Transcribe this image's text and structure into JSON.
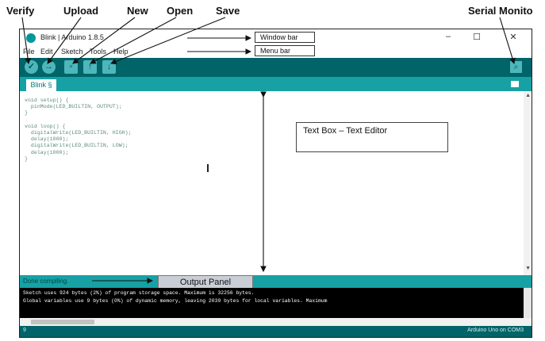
{
  "callouts": {
    "verify": "Verify",
    "upload": "Upload",
    "new": "New",
    "open": "Open",
    "save": "Save",
    "serial_monitor": "Serial Monito"
  },
  "window": {
    "title": "Blink | Arduino 1.8.5",
    "window_bar_label": "Window bar",
    "menu_bar_label": "Menu bar",
    "controls": [
      "–",
      "☐",
      "✕"
    ]
  },
  "menu": [
    "File",
    "Edit",
    "Sketch",
    "Tools",
    "Help"
  ],
  "toolbar": {
    "verify_icon": "✓",
    "upload_icon": "→",
    "new_icon": "▫",
    "open_icon": "↑",
    "save_icon": "↓",
    "serial_icon": "⌕"
  },
  "tab": {
    "label": "Blink §"
  },
  "editor": {
    "code": "void setup() {\n  pinMode(LED_BUILTIN, OUTPUT);\n}\n\nvoid loop() {\n  digitalWrite(LED_BUILTIN, HIGH);\n  delay(1000);\n  digitalWrite(LED_BUILTIN, LOW);\n  delay(1000);\n}"
  },
  "textbox_label": "Text Box – Text Editor",
  "status": {
    "text": "Done compiling.",
    "output_panel_label": "Output Panel"
  },
  "console": {
    "lines": [
      "Sketch uses 924 bytes (2%) of program storage space. Maximum is 32256 bytes.",
      "Global variables use 9 bytes (0%) of dynamic memory, leaving 2039 bytes for local variables. Maximum"
    ]
  },
  "bottom": {
    "line_number": "9",
    "board": "Arduino Uno on COM3"
  }
}
